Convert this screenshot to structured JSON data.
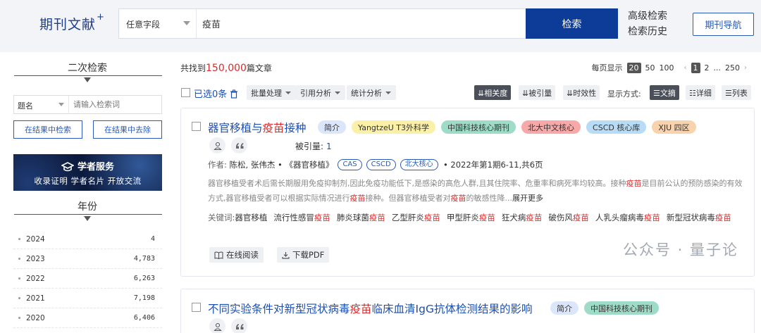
{
  "brand": {
    "title": "期刊文献",
    "sup": "+"
  },
  "search": {
    "field": "任意字段",
    "query": "疫苗",
    "button": "检索"
  },
  "links": {
    "advanced": "高级检索",
    "history": "检索历史",
    "journal_nav": "期刊导航"
  },
  "left": {
    "refine_title": "二次检索",
    "refine_field": "题名",
    "refine_placeholder": "请输入检索词",
    "btn_search_within": "在结果中检索",
    "btn_exclude": "在结果中去除",
    "banner_title": "学者服务",
    "banner_sub": "收录证明  学者名片  开放交流",
    "year_title": "年份",
    "years": [
      {
        "year": "2024",
        "count": "4"
      },
      {
        "year": "2023",
        "count": "4,783"
      },
      {
        "year": "2022",
        "count": "6,263"
      },
      {
        "year": "2021",
        "count": "7,198"
      },
      {
        "year": "2020",
        "count": "6,406"
      }
    ]
  },
  "results": {
    "found_prefix": "共找到",
    "found_count": "150,000",
    "found_suffix": "篇文章",
    "per_page_label": "每页显示",
    "per_page_options": [
      "20",
      "50",
      "100"
    ],
    "pages": [
      "1",
      "2",
      "...",
      "250"
    ]
  },
  "toolbar": {
    "selected": "已选0条",
    "batch": "批量处理",
    "citation_analysis": "引用分析",
    "stat_analysis": "统计分析",
    "sort_relevance": "相关度",
    "sort_cited": "被引量",
    "sort_time": "时效性",
    "view_label": "显示方式:",
    "view_abstract": "文摘",
    "view_detail": "详细",
    "view_list": "列表"
  },
  "articles": [
    {
      "title_pre": "器官移植与",
      "title_hl": "疫苗",
      "title_post": "接种",
      "tags": [
        {
          "label": "简介",
          "color": "#dbe6fa"
        },
        {
          "label": "YangtzeU T3外科学",
          "color": "#fbf0a8"
        },
        {
          "label": "中国科技核心期刊",
          "color": "#9fdcc8"
        },
        {
          "label": "北大中文核心",
          "color": "#f7a8a8"
        },
        {
          "label": "CSCD 核心库",
          "color": "#b8dcf5"
        },
        {
          "label": "XJU 四区",
          "color": "#f8d3ae"
        }
      ],
      "cited_label": "被引量:",
      "cited_value": "1",
      "author_label": "作者:",
      "authors": "陈松, 张伟杰",
      "journal": "《器官移植》",
      "db_pills": [
        "CAS",
        "CSCD",
        "北大核心"
      ],
      "issue": "2022年第1期6-11,共6页",
      "abstract_parts": [
        {
          "t": "器官移植受者术后需长期服用免疫抑制剂,因此免疫功能低下,是感染的高危人群,且其住院率、危重率和病死率均较高。接种",
          "h": false
        },
        {
          "t": "疫苗",
          "h": true
        },
        {
          "t": "是目前公认的预防感染的有效方式,器官移植受者可以根据实际情况进行",
          "h": false
        },
        {
          "t": "疫苗",
          "h": true
        },
        {
          "t": "接种。但器官移植受者对",
          "h": false
        },
        {
          "t": "疫苗",
          "h": true
        },
        {
          "t": "的敏感性降...",
          "h": false
        }
      ],
      "expand": "展开更多",
      "keywords_label": "关键词:",
      "keywords": [
        [
          {
            "t": "器官移植",
            "h": false
          }
        ],
        [
          {
            "t": "流行性感冒",
            "h": false
          },
          {
            "t": "疫苗",
            "h": true
          }
        ],
        [
          {
            "t": "肺炎球菌",
            "h": false
          },
          {
            "t": "疫苗",
            "h": true
          }
        ],
        [
          {
            "t": "乙型肝炎",
            "h": false
          },
          {
            "t": "疫苗",
            "h": true
          }
        ],
        [
          {
            "t": "甲型肝炎",
            "h": false
          },
          {
            "t": "疫苗",
            "h": true
          }
        ],
        [
          {
            "t": "狂犬病",
            "h": false
          },
          {
            "t": "疫苗",
            "h": true
          }
        ],
        [
          {
            "t": "破伤风",
            "h": false
          },
          {
            "t": "疫苗",
            "h": true
          }
        ],
        [
          {
            "t": "人乳头瘤病毒",
            "h": false
          },
          {
            "t": "疫苗",
            "h": true
          }
        ],
        [
          {
            "t": "新型冠状病毒",
            "h": false
          },
          {
            "t": "疫苗",
            "h": true
          }
        ]
      ],
      "read_online": "在线阅读",
      "download_pdf": "下载PDF"
    },
    {
      "title_pre": "不同实验条件对新型冠状病毒",
      "title_hl": "疫苗",
      "title_post": "临床血清IgG抗体检测结果的影响",
      "tags": [
        {
          "label": "简介",
          "color": "#dbe6fa"
        },
        {
          "label": "中国科技核心期刊",
          "color": "#9fdcc8"
        }
      ]
    }
  ],
  "watermark": "公众号 · 量子论"
}
